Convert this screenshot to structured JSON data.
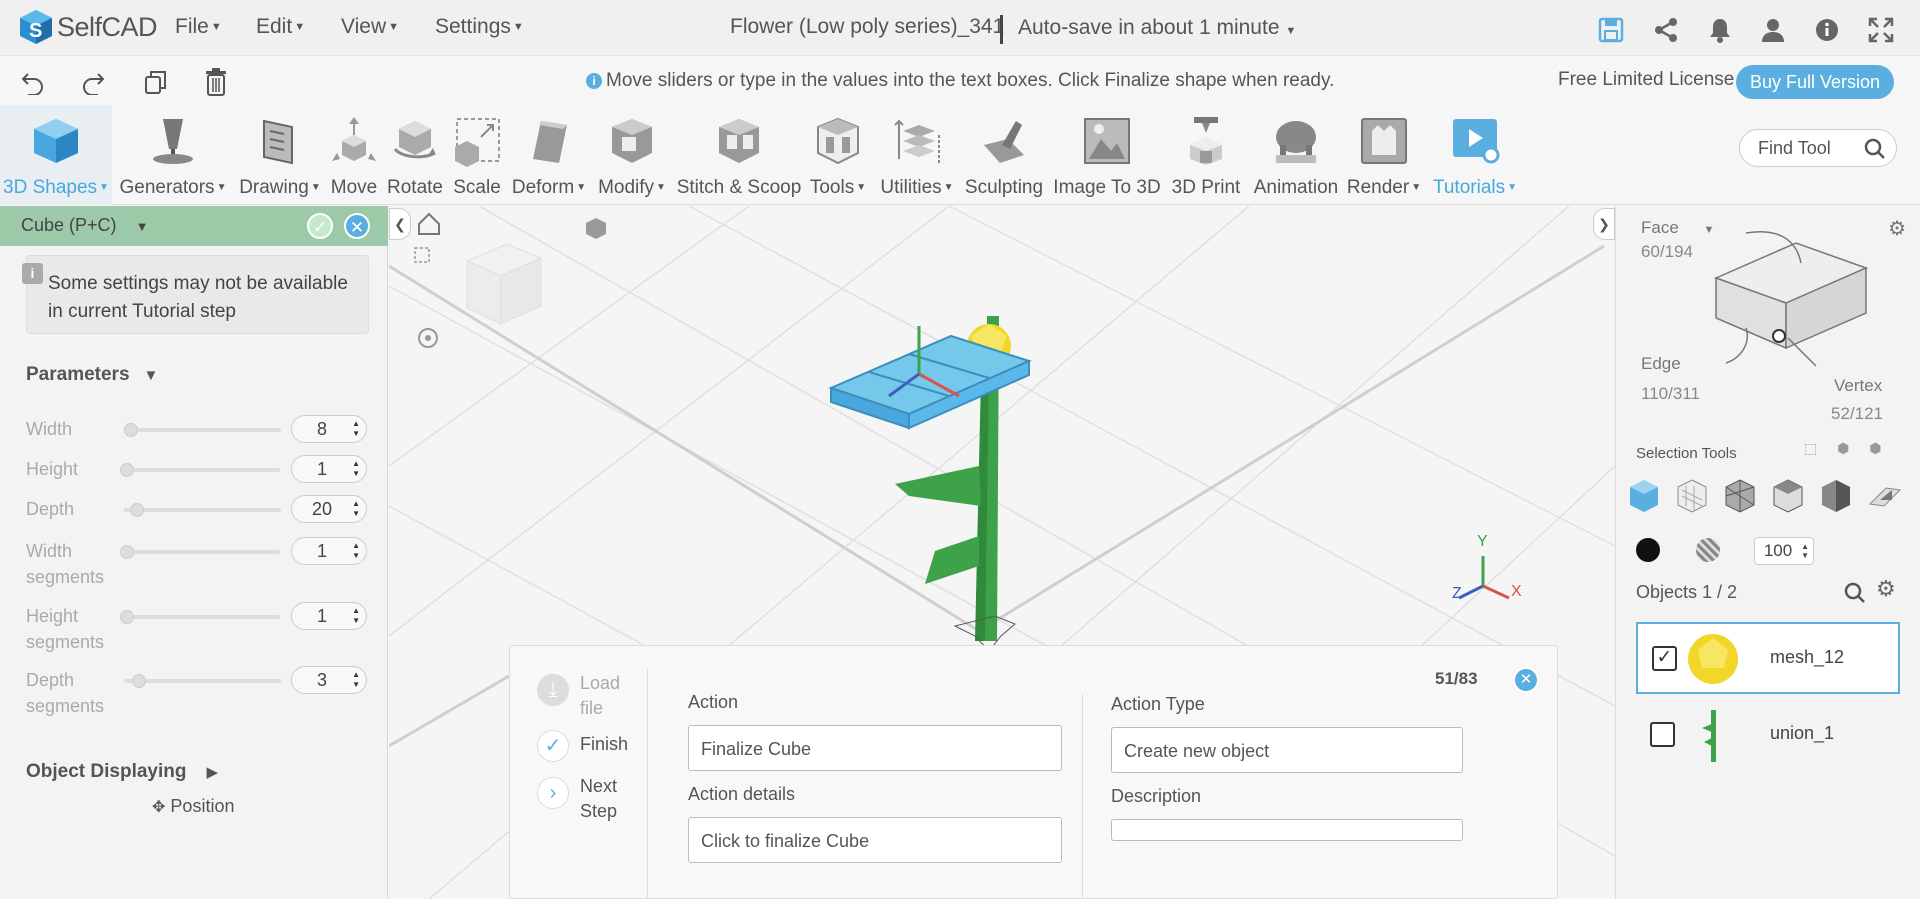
{
  "app": {
    "logo": "SelfCAD",
    "doc_title": "Flower (Low poly series)_341",
    "autosave": "Auto-save in about 1 minute"
  },
  "menu": [
    "File",
    "Edit",
    "View",
    "Settings"
  ],
  "hint": "Move sliders or type in the values into the text boxes. Click Finalize shape when ready.",
  "license": "Free Limited License",
  "buy_label": "Buy Full Version",
  "tools": [
    "3D Shapes",
    "Generators",
    "Drawing",
    "Move",
    "Rotate",
    "Scale",
    "Deform",
    "Modify",
    "Stitch & Scoop",
    "Tools",
    "Utilities",
    "Sculpting",
    "Image To 3D",
    "3D Print",
    "Animation",
    "Render",
    "Tutorials"
  ],
  "find_tool": "Find Tool",
  "left_panel": {
    "title": "Cube (P+C)",
    "notice": "Some settings may not be available in current Tutorial step",
    "parameters_label": "Parameters",
    "params": [
      {
        "label": "Width",
        "value": "8",
        "fraction": 0.02
      },
      {
        "label": "Height",
        "value": "1",
        "fraction": 0.0
      },
      {
        "label": "Depth",
        "value": "20",
        "fraction": 0.06
      },
      {
        "label": "Width segments",
        "value": "1",
        "fraction": 0.0
      },
      {
        "label": "Height segments",
        "value": "1",
        "fraction": 0.0
      },
      {
        "label": "Depth segments",
        "value": "3",
        "fraction": 0.07
      }
    ],
    "object_displaying": "Object Displaying",
    "position": "Position"
  },
  "right_panel": {
    "face": "Face",
    "face_count": "60/194",
    "edge": "Edge",
    "edge_count": "110/311",
    "vertex": "Vertex",
    "vertex_count": "52/121",
    "selection_tools": "Selection Tools",
    "opacity": "100",
    "objects": "Objects 1 / 2",
    "items": [
      {
        "name": "mesh_12",
        "checked": true
      },
      {
        "name": "union_1",
        "checked": false
      }
    ]
  },
  "popup": {
    "counter": "51/83",
    "steps": [
      "Load file",
      "Finish",
      "Next Step"
    ],
    "action_label": "Action",
    "action_value": "Finalize Cube",
    "details_label": "Action details",
    "details_value": "Click to finalize Cube",
    "type_label": "Action Type",
    "type_value": "Create new object",
    "desc_label": "Description",
    "desc_value": ""
  },
  "axes": {
    "x": "X",
    "y": "Y",
    "z": "Z"
  },
  "colors": {
    "accent": "#5aaee0",
    "panel_header": "#9cc9a7",
    "stem": "#3ea24a",
    "petal": "#f2d62a",
    "cube": "#74c9ea"
  }
}
